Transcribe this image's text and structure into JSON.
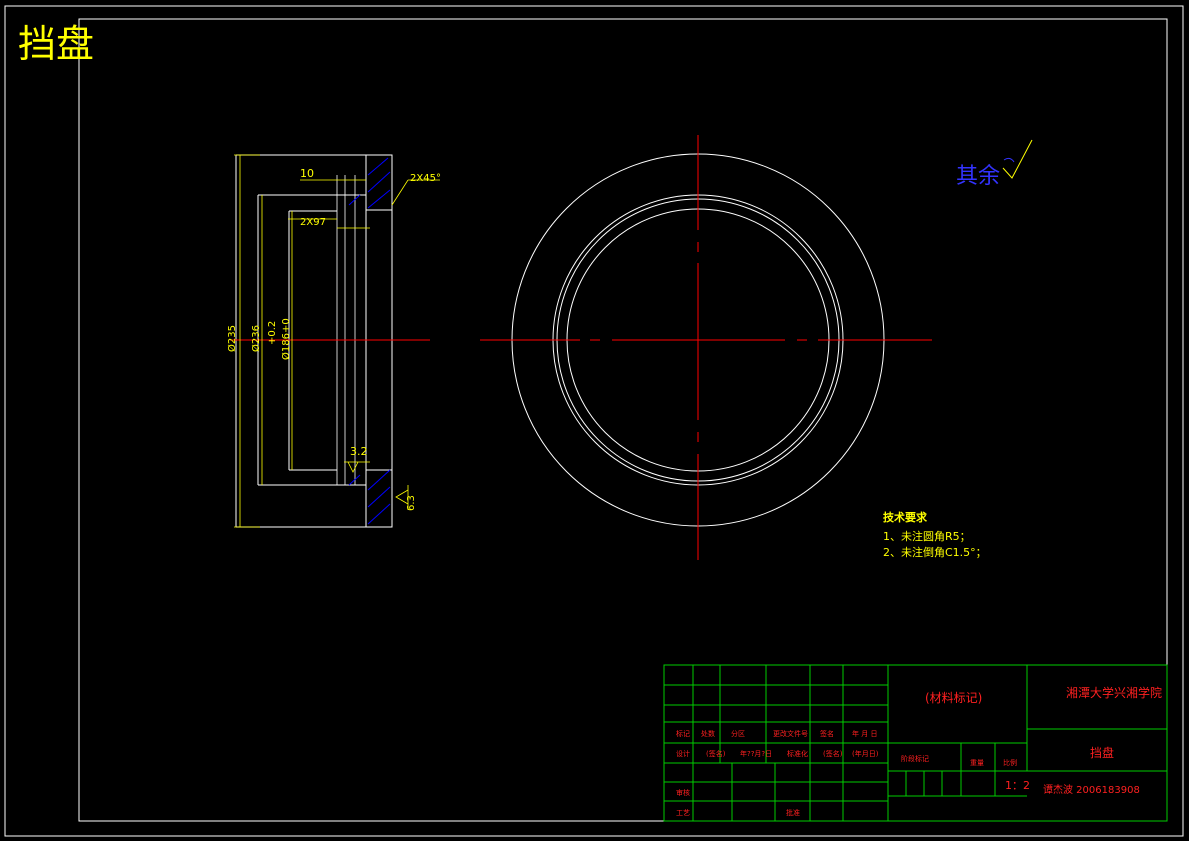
{
  "drawing_title": "挡盘",
  "roughness_note": "其余",
  "dimensions": {
    "width_10": "10",
    "chamfer": "2X45°",
    "groove": "2X97",
    "dia_outer": "Ø235",
    "dia_mid": "Ø236",
    "dia_inner": "Ø186+0",
    "tolerance": "+0.2",
    "roughness_inner": "3.2",
    "roughness_right": "6.3"
  },
  "tech_requirements": {
    "title": "技术要求",
    "items": [
      "1、未注圆角R5；",
      "2、未注倒角C1.5°；"
    ]
  },
  "title_block": {
    "material_label": "(材料标记)",
    "school": "湘潭大学兴湘学院",
    "part_name": "挡盘",
    "scale": "1：2",
    "student": "谭杰波 2006183908",
    "row_labels": [
      "标记",
      "设计",
      "审核",
      "工艺"
    ],
    "header_cells": [
      "处数",
      "分区",
      "更改文件号",
      "签名",
      "年 月 日"
    ],
    "design_row": [
      "(签名)",
      "年??月?日",
      "标准化",
      "(签名)",
      "(年月日)"
    ],
    "stage_label": "阶段标记",
    "weight_label": "重量",
    "ratio_label": "比例",
    "approve_label": "批准"
  },
  "colors": {
    "background": "#000000",
    "lines": "#ffffff",
    "center_lines": "#ff0000",
    "dimensions": "#ffff00",
    "hatch": "#0000ff",
    "title_block": "#00cc00",
    "title_text": "#ff2020",
    "note_blue": "#3333ff"
  }
}
